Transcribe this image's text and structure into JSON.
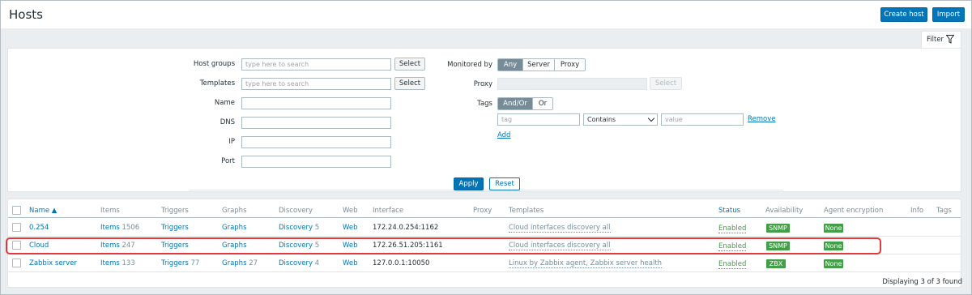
{
  "page": {
    "title": "Hosts"
  },
  "header": {
    "create_host": "Create host",
    "import": "Import"
  },
  "filter": {
    "tab_label": "Filter",
    "host_groups_label": "Host groups",
    "host_groups_placeholder": "type here to search",
    "templates_label": "Templates",
    "templates_placeholder": "type here to search",
    "select_label": "Select",
    "name_label": "Name",
    "dns_label": "DNS",
    "ip_label": "IP",
    "port_label": "Port",
    "monitored_by_label": "Monitored by",
    "monitored_by_options": [
      "Any",
      "Server",
      "Proxy"
    ],
    "monitored_by_selected": "Any",
    "proxy_label": "Proxy",
    "tags_label": "Tags",
    "tags_options": [
      "And/Or",
      "Or"
    ],
    "tags_selected": "And/Or",
    "tag_placeholder": "tag",
    "operator_value": "Contains",
    "value_placeholder": "value",
    "remove_label": "Remove",
    "add_label": "Add",
    "apply_label": "Apply",
    "reset_label": "Reset"
  },
  "table": {
    "columns": {
      "name": "Name ▲",
      "items": "Items",
      "triggers": "Triggers",
      "graphs": "Graphs",
      "discovery": "Discovery",
      "web": "Web",
      "interface": "Interface",
      "proxy": "Proxy",
      "templates": "Templates",
      "status": "Status",
      "availability": "Availability",
      "agent_encryption": "Agent encryption",
      "info": "Info",
      "tags": "Tags"
    },
    "rows": [
      {
        "name": "0.254",
        "items_label": "Items",
        "items_count": "1506",
        "triggers_label": "Triggers",
        "triggers_count": "",
        "graphs_label": "Graphs",
        "graphs_count": "",
        "discovery_label": "Discovery",
        "discovery_count": "5",
        "web": "Web",
        "interface": "172.24.0.254:1162",
        "templates": "Cloud interfaces discovery all",
        "status": "Enabled",
        "availability": "SNMP",
        "encryption": "None"
      },
      {
        "name": "Cloud",
        "items_label": "Items",
        "items_count": "247",
        "triggers_label": "Triggers",
        "triggers_count": "",
        "graphs_label": "Graphs",
        "graphs_count": "",
        "discovery_label": "Discovery",
        "discovery_count": "5",
        "web": "Web",
        "interface": "172.26.51.205:1161",
        "templates": "Cloud interfaces discovery all",
        "status": "Enabled",
        "availability": "SNMP",
        "encryption": "None"
      },
      {
        "name": "Zabbix server",
        "items_label": "Items",
        "items_count": "133",
        "triggers_label": "Triggers",
        "triggers_count": "77",
        "graphs_label": "Graphs",
        "graphs_count": "27",
        "discovery_label": "Discovery",
        "discovery_count": "4",
        "web": "Web",
        "interface": "127.0.0.1:10050",
        "templates": "Linux by Zabbix agent, Zabbix server health",
        "status": "Enabled",
        "availability": "ZBX",
        "encryption": "None"
      }
    ],
    "footer": "Displaying 3 of 3 found"
  },
  "colors": {
    "accent": "#0275b8",
    "enabled": "#429e47",
    "highlight": "#e0393e"
  }
}
